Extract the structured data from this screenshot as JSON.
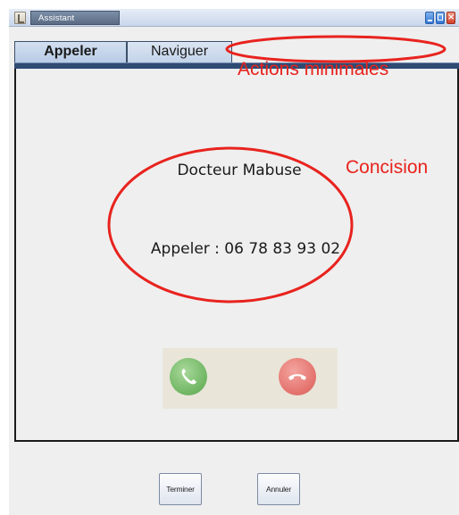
{
  "window": {
    "title": "Assistant",
    "controls": [
      "minimize-icon",
      "maximize-icon",
      "close-icon"
    ],
    "close_glyph": "×"
  },
  "tabs": [
    {
      "label": "Appeler",
      "active": true
    },
    {
      "label": "Naviguer",
      "active": false
    }
  ],
  "call": {
    "contact_name": "Docteur Mabuse",
    "call_text": "Appeler : 06 78 83 93 02",
    "accept_icon": "phone-accept-icon",
    "reject_icon": "phone-hangup-icon"
  },
  "buttons": {
    "end_label": "Terminer",
    "cancel_label": "Annuler"
  },
  "annotations": {
    "actions_label": "Actions minimales",
    "concision_label": "Concision",
    "color": "#e8231e"
  },
  "colors": {
    "tab_strip": "#2f4b73",
    "accept_green": "#6fb562",
    "reject_red": "#e3706b"
  }
}
